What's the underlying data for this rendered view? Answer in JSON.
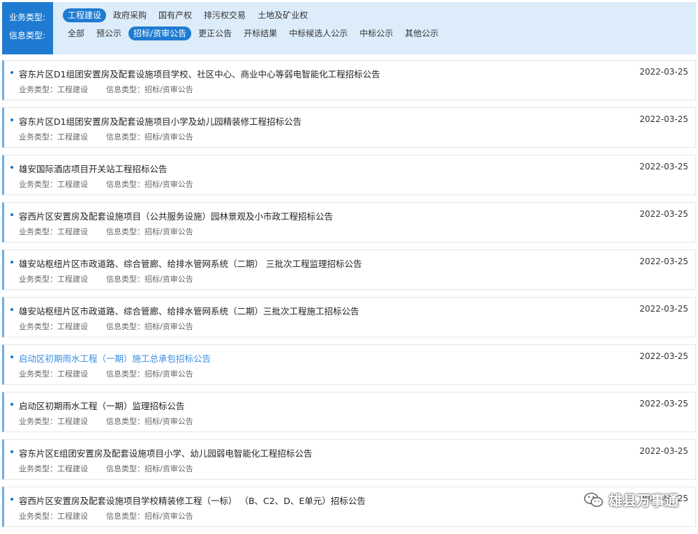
{
  "filters": {
    "business_label": "业务类型:",
    "info_label": "信息类型:",
    "business_types": [
      {
        "label": "工程建设",
        "active": true
      },
      {
        "label": "政府采购",
        "active": false
      },
      {
        "label": "国有产权",
        "active": false
      },
      {
        "label": "排污权交易",
        "active": false
      },
      {
        "label": "土地及矿业权",
        "active": false
      }
    ],
    "info_types": [
      {
        "label": "全部",
        "active": false
      },
      {
        "label": "预公示",
        "active": false
      },
      {
        "label": "招标/资审公告",
        "active": true
      },
      {
        "label": "更正公告",
        "active": false
      },
      {
        "label": "开标结果",
        "active": false
      },
      {
        "label": "中标候选人公示",
        "active": false
      },
      {
        "label": "中标公示",
        "active": false
      },
      {
        "label": "其他公示",
        "active": false
      }
    ]
  },
  "list": {
    "meta_business_label": "业务类型：",
    "meta_info_label": "信息类型：",
    "items": [
      {
        "title": "容东片区D1组团安置房及配套设施项目学校、社区中心、商业中心等弱电智能化工程招标公告",
        "date": "2022-03-25",
        "business": "工程建设",
        "info": "招标/资审公告",
        "highlight": false
      },
      {
        "title": "容东片区D1组团安置房及配套设施项目小学及幼儿园精装修工程招标公告",
        "date": "2022-03-25",
        "business": "工程建设",
        "info": "招标/资审公告",
        "highlight": false
      },
      {
        "title": "雄安国际酒店项目开关站工程招标公告",
        "date": "2022-03-25",
        "business": "工程建设",
        "info": "招标/资审公告",
        "highlight": false
      },
      {
        "title": "容西片区安置房及配套设施项目（公共服务设施）园林景观及小市政工程招标公告",
        "date": "2022-03-25",
        "business": "工程建设",
        "info": "招标/资审公告",
        "highlight": false
      },
      {
        "title": "雄安站枢纽片区市政道路、综合管廊、给排水管网系统（二期） 三批次工程监理招标公告",
        "date": "2022-03-25",
        "business": "工程建设",
        "info": "招标/资审公告",
        "highlight": false
      },
      {
        "title": "雄安站枢纽片区市政道路、综合管廊、给排水管网系统（二期）三批次工程施工招标公告",
        "date": "2022-03-25",
        "business": "工程建设",
        "info": "招标/资审公告",
        "highlight": false
      },
      {
        "title": "启动区初期雨水工程（一期）施工总承包招标公告",
        "date": "2022-03-25",
        "business": "工程建设",
        "info": "招标/资审公告",
        "highlight": true
      },
      {
        "title": "启动区初期雨水工程（一期）监理招标公告",
        "date": "2022-03-25",
        "business": "工程建设",
        "info": "招标/资审公告",
        "highlight": false
      },
      {
        "title": "容东片区E组团安置房及配套设施项目小学、幼儿园弱电智能化工程招标公告",
        "date": "2022-03-25",
        "business": "工程建设",
        "info": "招标/资审公告",
        "highlight": false
      },
      {
        "title": "容西片区安置房及配套设施项目学校精装修工程（一标） （B、C2、D、E单元）招标公告",
        "date": "2022-03-25",
        "business": "工程建设",
        "info": "招标/资审公告",
        "highlight": false
      }
    ]
  },
  "watermark": {
    "text": "雄县万事通",
    "icon": "wechat-icon"
  },
  "colors": {
    "accent": "#1f7bd1",
    "panel_bg": "#dcecfa",
    "link": "#3a8ee0",
    "row_border_left": "#6aaee8"
  }
}
